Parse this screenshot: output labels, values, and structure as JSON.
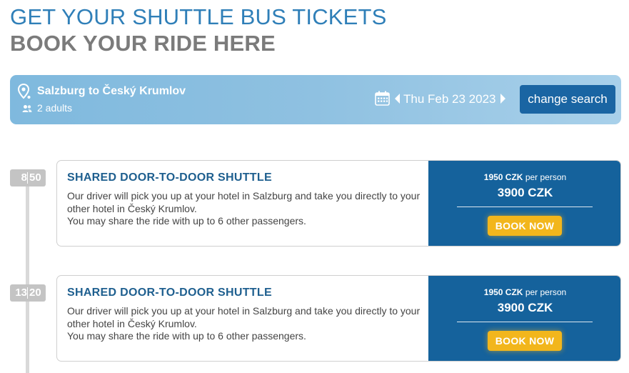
{
  "header": {
    "title": "GET YOUR SHUTTLE BUS TICKETS",
    "subtitle": "BOOK YOUR RIDE HERE"
  },
  "search": {
    "route": "Salzburg to Český Krumlov",
    "passengers": "2 adults",
    "date": "Thu Feb 23 2023",
    "change_label": "change search",
    "icons": [
      "map-pin-icon",
      "people-icon",
      "calendar-icon",
      "chevron-left-icon",
      "chevron-right-icon"
    ]
  },
  "results": [
    {
      "hour": "8",
      "minute": "50",
      "title": "SHARED DOOR-TO-DOOR SHUTTLE",
      "desc_line1": "Our driver will pick you up at your hotel in Salzburg and take you directly to your",
      "desc_line2": "other hotel in Český Krumlov.",
      "desc_line3": "You may share the ride with up to 6 other passengers.",
      "price_per_person": "1950 CZK",
      "per_person_label": "per person",
      "total_price": "3900 CZK",
      "book_label": "BOOK NOW"
    },
    {
      "hour": "13",
      "minute": "20",
      "title": "SHARED DOOR-TO-DOOR SHUTTLE",
      "desc_line1": "Our driver will pick you up at your hotel in Salzburg and take you directly to your",
      "desc_line2": "other hotel in Český Krumlov.",
      "desc_line3": "You may share the ride with up to 6 other passengers.",
      "price_per_person": "1950 CZK",
      "per_person_label": "per person",
      "total_price": "3900 CZK",
      "book_label": "BOOK NOW"
    }
  ],
  "colors": {
    "title_blue": "#2f7fb8",
    "subtitle_gray": "#7b7b7b",
    "search_bar": "#8fc1e1",
    "primary_button": "#1a65a3",
    "price_panel": "#15629c",
    "book_button": "#f2b61c",
    "card_title": "#1e5f8f"
  }
}
